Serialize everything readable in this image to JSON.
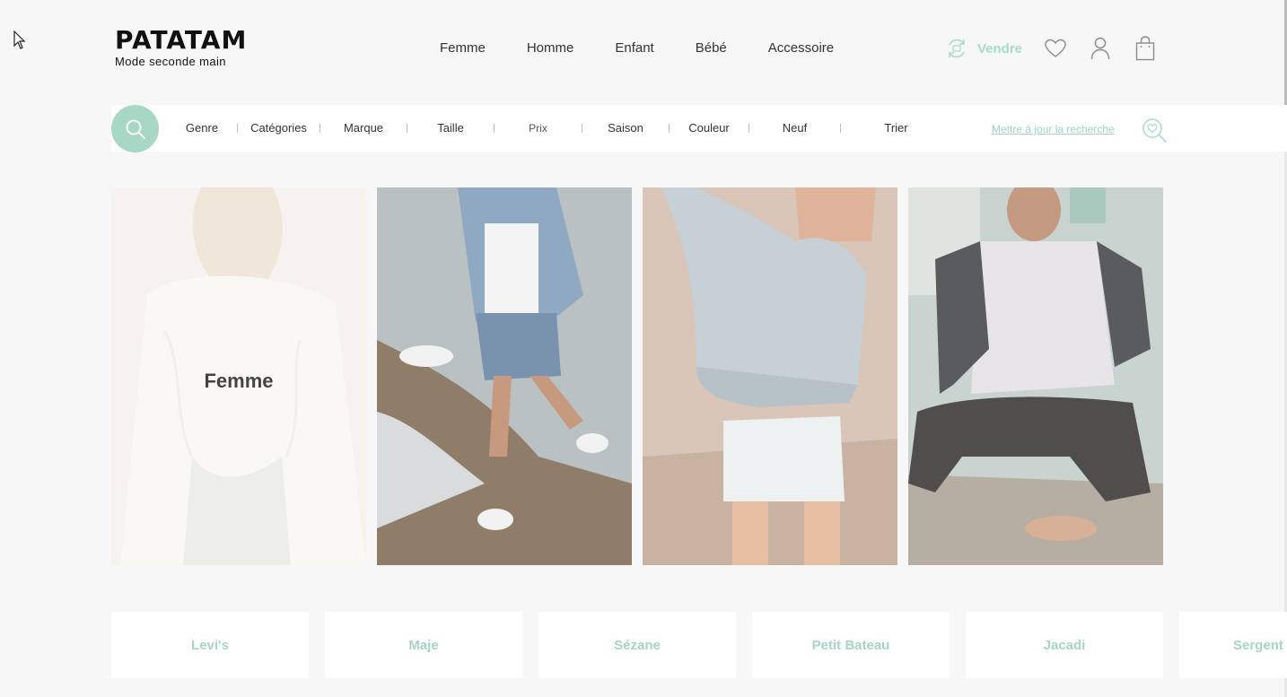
{
  "logo": {
    "title": "PATATAM",
    "subtitle": "Mode seconde main"
  },
  "nav": {
    "items": [
      "Femme",
      "Homme",
      "Enfant",
      "Bébé",
      "Accessoire"
    ]
  },
  "actions": {
    "sell_label": "Vendre"
  },
  "search": {
    "filters": [
      "Genre",
      "Catégories",
      "Marque",
      "Taille",
      "Prix",
      "Saison",
      "Couleur",
      "Neuf",
      "Trier"
    ],
    "update_label": "Mettre à jour la recherche"
  },
  "tiles": [
    {
      "label": "Femme"
    }
  ],
  "brands": [
    "Levi's",
    "Maje",
    "Sézane",
    "Petit Bateau",
    "Jacadi",
    "Sergent"
  ],
  "colors": {
    "accent": "#a8d8c5",
    "brand_text": "#a6d6c2",
    "background": "#f7f7f7"
  },
  "icons": [
    "cursor-icon",
    "sell-recycle-icon",
    "heart-icon",
    "user-icon",
    "bag-icon",
    "search-icon",
    "search-heart-icon"
  ]
}
